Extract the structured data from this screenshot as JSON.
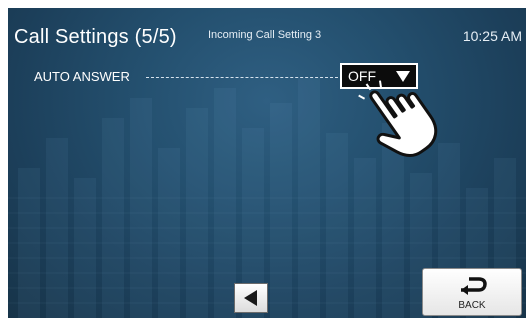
{
  "header": {
    "title": "Call Settings (5/5)",
    "subtitle": "Incoming Call Setting 3",
    "time": "10:25 AM"
  },
  "settings": {
    "auto_answer": {
      "label": "AUTO ANSWER",
      "value": "OFF"
    }
  },
  "nav": {
    "back_label": "BACK"
  },
  "icons": {
    "dropdown": "triangle-down-icon",
    "prev": "triangle-left-icon",
    "back": "return-arrow-icon",
    "hint": "pointing-hand-icon"
  },
  "colors": {
    "background": "#24506f",
    "text": "#ffffff",
    "select_bg": "#0c0c0c"
  }
}
